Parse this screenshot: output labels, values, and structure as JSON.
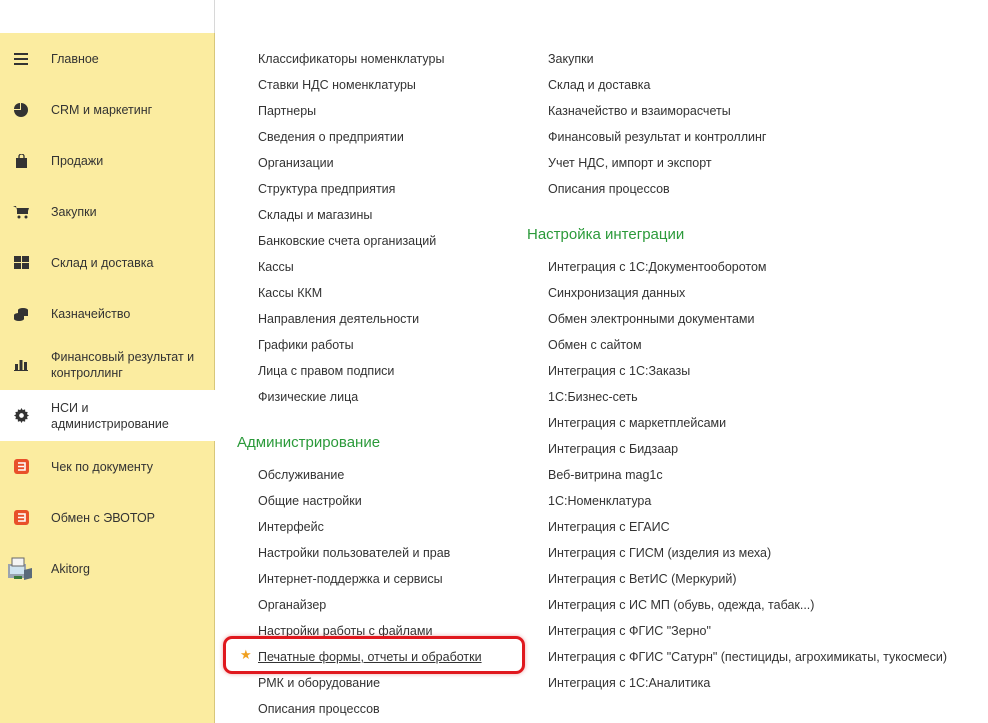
{
  "sidebar": {
    "items": [
      {
        "label": "Главное",
        "icon": "menu-lines-icon"
      },
      {
        "label": "CRM и маркетинг",
        "icon": "pie-chart-icon"
      },
      {
        "label": "Продажи",
        "icon": "shopping-bag-icon"
      },
      {
        "label": "Закупки",
        "icon": "cart-icon"
      },
      {
        "label": "Склад и доставка",
        "icon": "warehouse-grid-icon"
      },
      {
        "label": "Казначейство",
        "icon": "coins-icon"
      },
      {
        "label": "Финансовый результат и контроллинг",
        "icon": "bar-chart-icon"
      },
      {
        "label": "НСИ и администрирование",
        "icon": "gear-icon",
        "active": true
      },
      {
        "label": "Чек по документу",
        "icon": "evotor-icon"
      },
      {
        "label": "Обмен с ЭВОТОР",
        "icon": "evotor-icon"
      },
      {
        "label": "Akitorg",
        "icon": "akitorg-icon"
      }
    ]
  },
  "colors": {
    "sidebar_bg": "#fbeca0",
    "section_title": "#2b9a3a",
    "highlight": "#e0181e",
    "star": "#f0a020"
  },
  "left_column": {
    "links": [
      "Классификаторы номенклатуры",
      "Ставки НДС номенклатуры",
      "Партнеры",
      "Сведения о предприятии",
      "Организации",
      "Структура предприятия",
      "Склады и магазины",
      "Банковские счета организаций",
      "Кассы",
      "Кассы ККМ",
      "Направления деятельности",
      "Графики работы",
      "Лица с правом подписи",
      "Физические лица"
    ],
    "admin_title": "Администрирование",
    "admin_links": [
      "Обслуживание",
      "Общие настройки",
      "Интерфейс",
      "Настройки пользователей и прав",
      "Интернет-поддержка и сервисы",
      "Органайзер",
      "Настройки работы с файлами",
      "Печатные формы, отчеты и обработки",
      "РМК и оборудование",
      "Описания процессов"
    ]
  },
  "right_column": {
    "links": [
      "Закупки",
      "Склад и доставка",
      "Казначейство и взаиморасчеты",
      "Финансовый результат и контроллинг",
      "Учет НДС, импорт и экспорт",
      "Описания процессов"
    ],
    "integration_title": "Настройка интеграции",
    "integration_links": [
      "Интеграция с 1С:Документооборотом",
      "Синхронизация данных",
      "Обмен электронными документами",
      "Обмен с сайтом",
      "Интеграция с 1С:Заказы",
      "1С:Бизнес-сеть",
      "Интеграция с маркетплейсами",
      "Интеграция с Бидзаар",
      "Веб-витрина mag1c",
      "1С:Номенклатура",
      "Интеграция с ЕГАИС",
      "Интеграция с ГИСМ (изделия из меха)",
      "Интеграция с ВетИС (Меркурий)",
      "Интеграция с ИС МП (обувь, одежда, табак...)",
      "Интеграция с ФГИС \"Зерно\"",
      "Интеграция с ФГИС \"Сатурн\" (пестициды, агрохимикаты, тукосмеси)",
      "Интеграция с 1С:Аналитика"
    ]
  },
  "favorite_star": "★"
}
